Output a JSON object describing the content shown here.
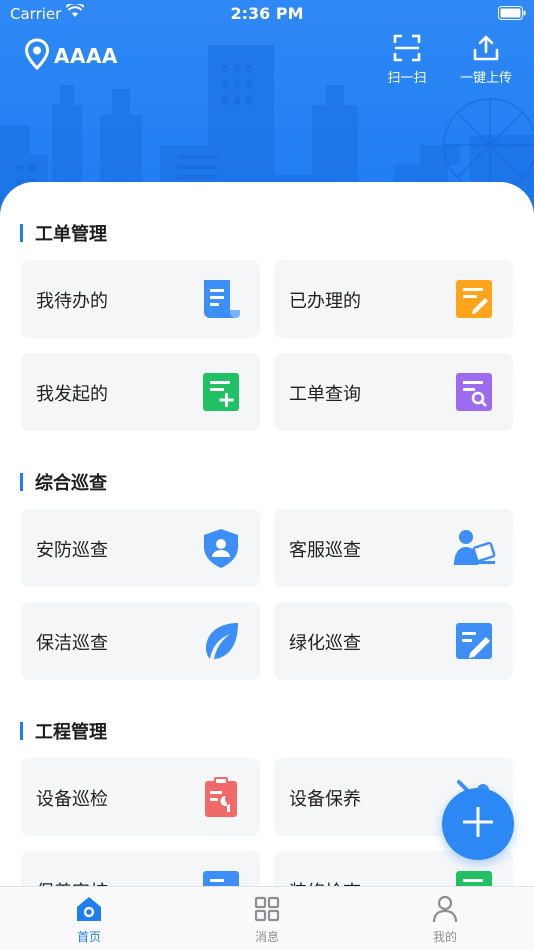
{
  "status_bar": {
    "carrier": "Carrier",
    "time": "2:36 PM"
  },
  "header": {
    "location": "AAAA",
    "scan_label": "扫一扫",
    "upload_label": "一键上传"
  },
  "sections": [
    {
      "title": "工单管理",
      "tiles": [
        {
          "label": "我待办的",
          "icon": "document-list-icon",
          "color": "#3d8ef7"
        },
        {
          "label": "已办理的",
          "icon": "document-edit-icon",
          "color": "#ffa41b"
        },
        {
          "label": "我发起的",
          "icon": "document-add-icon",
          "color": "#22c064"
        },
        {
          "label": "工单查询",
          "icon": "document-search-icon",
          "color": "#9b6cf0"
        }
      ]
    },
    {
      "title": "综合巡查",
      "tiles": [
        {
          "label": "安防巡查",
          "icon": "security-shield-icon",
          "color": "#3d8ef7"
        },
        {
          "label": "客服巡查",
          "icon": "customer-service-icon",
          "color": "#3d8ef7"
        },
        {
          "label": "保洁巡查",
          "icon": "leaf-icon",
          "color": "#3d8ef7"
        },
        {
          "label": "绿化巡查",
          "icon": "edit-square-icon",
          "color": "#3d8ef7"
        }
      ]
    },
    {
      "title": "工程管理",
      "tiles": [
        {
          "label": "设备巡检",
          "icon": "clipboard-wrench-icon",
          "color": "#f06a6a"
        },
        {
          "label": "设备保养",
          "icon": "maintenance-icon",
          "color": "#3d8ef7"
        },
        {
          "label": "保养审核",
          "icon": "review-icon",
          "color": "#3d8ef7"
        },
        {
          "label": "装修检查",
          "icon": "inspection-icon",
          "color": "#22c064"
        }
      ]
    }
  ],
  "tabbar": {
    "items": [
      {
        "label": "首页",
        "icon": "home-icon",
        "active": true
      },
      {
        "label": "消息",
        "icon": "grid-icon",
        "active": false
      },
      {
        "label": "我的",
        "icon": "user-icon",
        "active": false
      }
    ]
  },
  "colors": {
    "primary": "#1f7df2",
    "tile_bg": "#f5f6f8"
  }
}
